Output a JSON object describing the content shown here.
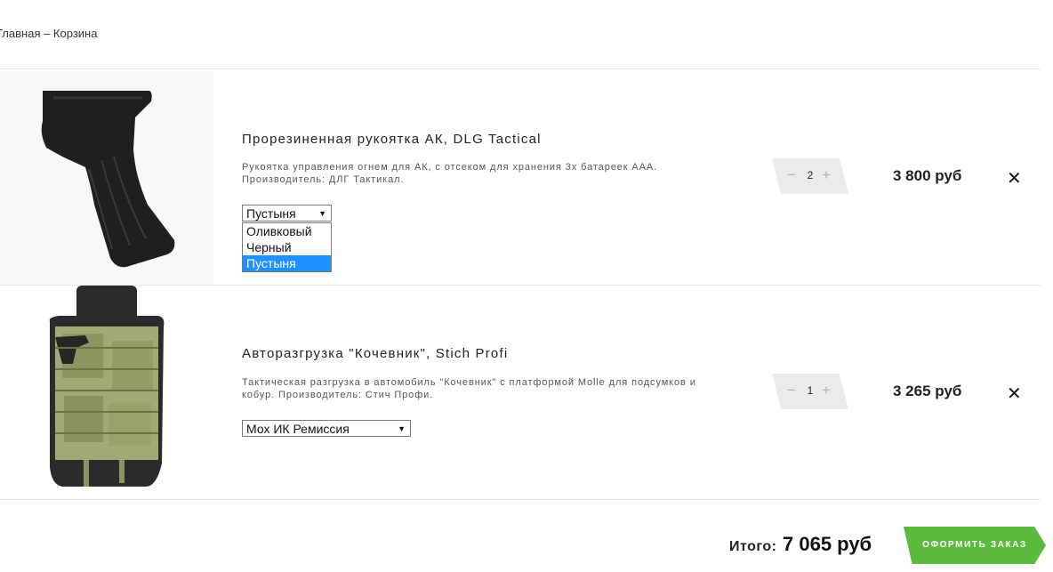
{
  "breadcrumb": {
    "text": "Главная – Корзина"
  },
  "items": [
    {
      "title": "Прорезиненная рукоятка АК, DLG Tactical",
      "desc_line1": "Рукоятка управления огнем для АК, с отсеком для хранения 3х батареек ААА.",
      "desc_line2": "Производитель: ДЛГ Тактикал.",
      "select_value": "Пустыня",
      "options": [
        "Оливковый",
        "Черный",
        "Пустыня"
      ],
      "qty_minus": "−",
      "qty": "2",
      "qty_plus": "+",
      "price": "3 800 руб",
      "remove": "✕"
    },
    {
      "title": "Авторазгрузка \"Кочевник\", Stich Profi",
      "desc_line1": "Тактическая разгрузка в автомобиль \"Кочевник\" с платформой Molle для подсумков и",
      "desc_line2": "кобур. Производитель: Стич Профи.",
      "select_value": "Мох ИК Ремиссия",
      "qty_minus": "−",
      "qty": "1",
      "qty_plus": "+",
      "price": "3 265 руб",
      "remove": "✕"
    }
  ],
  "summary": {
    "total_label": "Итого:",
    "total_value": "7 065 руб",
    "checkout_label": "ОФОРМИТЬ ЗАКАЗ"
  },
  "colors": {
    "accent": "#5bbb3c",
    "selected_option": "#1e90ff"
  }
}
